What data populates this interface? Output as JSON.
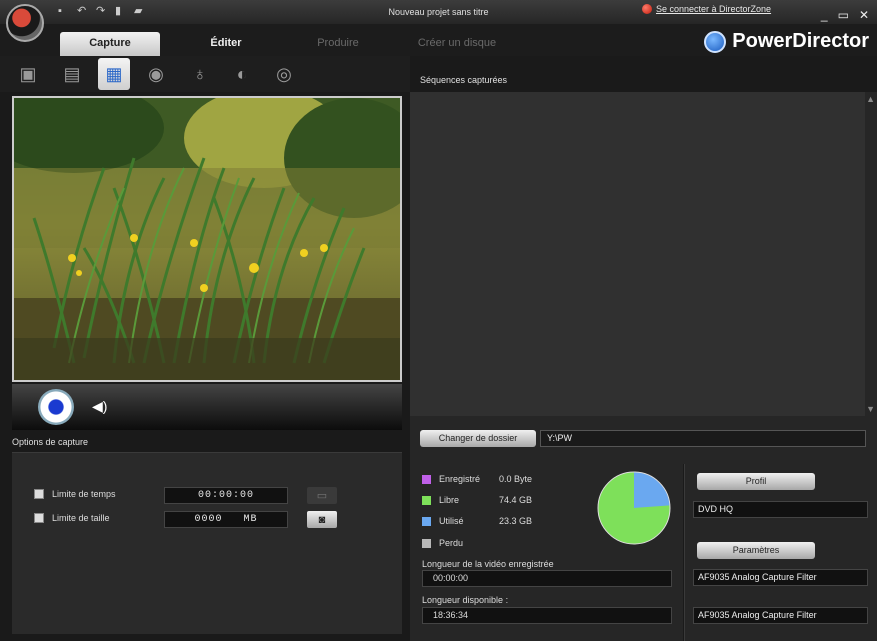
{
  "titlebar": {
    "title": "Nouveau projet sans titre",
    "directorzone_link": "Se connecter à DirectorZone",
    "min_icon": "minimize-icon",
    "restore_icon": "restore-icon",
    "close_icon": "close-icon"
  },
  "tabs": [
    {
      "label": "Capture",
      "state": "active"
    },
    {
      "label": "Éditer",
      "state": "normal"
    },
    {
      "label": "Produire",
      "state": "disabled"
    },
    {
      "label": "Créer un disque",
      "state": "disabled"
    }
  ],
  "brand": {
    "name": "PowerDirector",
    "icon": "upgrade-arrow-icon"
  },
  "capture_modes": [
    {
      "icon": "dv-camcorder-icon",
      "state": "normal"
    },
    {
      "icon": "hdv-camcorder-icon",
      "state": "normal"
    },
    {
      "icon": "tv-capture-icon",
      "state": "active"
    },
    {
      "icon": "webcam-icon",
      "state": "normal"
    },
    {
      "icon": "microphone-icon",
      "state": "normal"
    },
    {
      "icon": "cd-audio-icon",
      "state": "normal"
    },
    {
      "icon": "dvd-icon",
      "state": "normal"
    }
  ],
  "capture_options": {
    "label": "Options de capture",
    "time_limit": {
      "label": "Limite de temps",
      "value": "00:00:00"
    },
    "size_limit": {
      "label": "Limite de taille",
      "value": "0000",
      "unit": "MB"
    }
  },
  "sequences": {
    "label": "Séquences capturées"
  },
  "folder": {
    "button": "Changer de dossier",
    "path": "Y:\\PW"
  },
  "disk": {
    "legend": [
      {
        "name": "Enregistré",
        "value": "0.0 Byte",
        "color": "#c060e8"
      },
      {
        "name": "Libre",
        "value": "74.4 GB",
        "color": "#7ee05a"
      },
      {
        "name": "Utilisé",
        "value": "23.3 GB",
        "color": "#6aa8f0"
      },
      {
        "name": "Perdu",
        "value": "",
        "color": "#b8b8b8"
      }
    ],
    "recorded_length_label": "Longueur de la vidéo enregistrée",
    "recorded_length": "00:00:00",
    "available_length_label": "Longueur disponible :",
    "available_length": "18:36:34",
    "free_gb": 74.4,
    "used_gb": 23.3
  },
  "profile": {
    "button": "Profil",
    "value": "DVD HQ",
    "params_button": "Paramètres",
    "filter1": "AF9035 Analog Capture Filter",
    "filter2": "AF9035 Analog Capture Filter"
  }
}
